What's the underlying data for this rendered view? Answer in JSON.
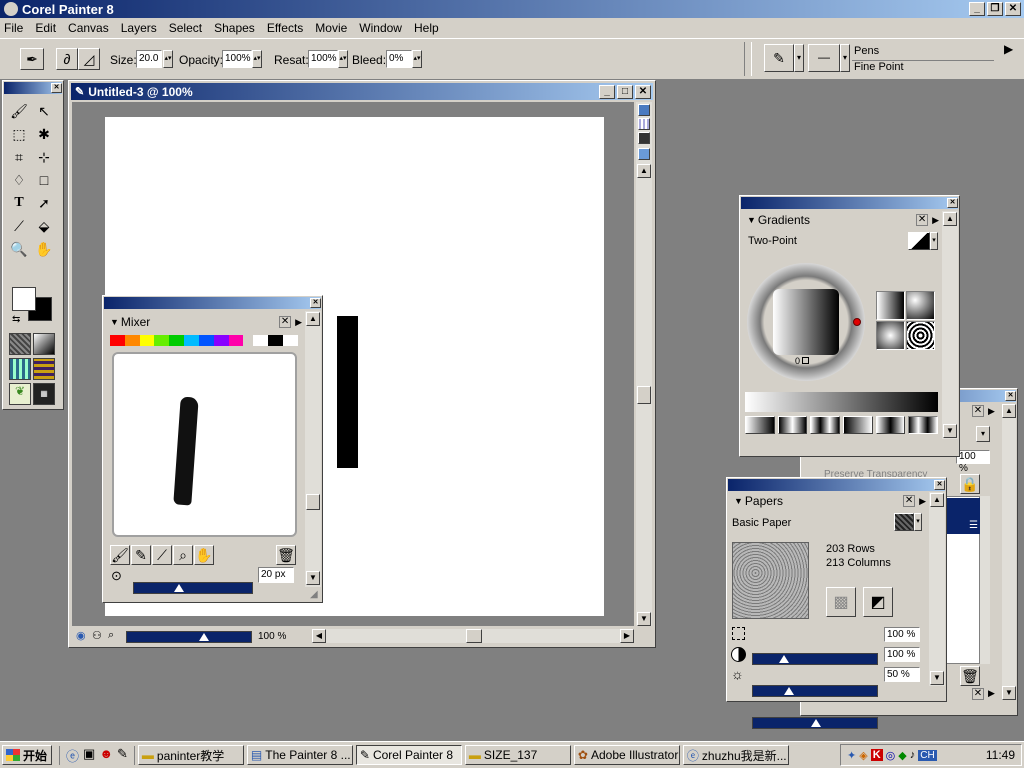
{
  "app": {
    "title": "Corel Painter 8"
  },
  "menu": [
    "File",
    "Edit",
    "Canvas",
    "Layers",
    "Select",
    "Shapes",
    "Effects",
    "Movie",
    "Window",
    "Help"
  ],
  "propbar": {
    "size_label": "Size:",
    "size_value": "20.0",
    "opacity_label": "Opacity:",
    "opacity_value": "100%",
    "resat_label": "Resat:",
    "resat_value": "100%",
    "bleed_label": "Bleed:",
    "bleed_value": "0%",
    "brush_category": "Pens",
    "brush_variant": "Fine Point"
  },
  "document": {
    "title": "Untitled-3 @ 100%",
    "zoom": "100 %"
  },
  "mixer": {
    "title": "Mixer",
    "size": "20 px",
    "swatches": [
      "#ff0000",
      "#ff8800",
      "#ffff00",
      "#66ee00",
      "#00cc00",
      "#00bbff",
      "#0055ff",
      "#8800ff",
      "#ff00aa",
      "#ffffff",
      "#000000",
      "#ffffff"
    ]
  },
  "gradients": {
    "title": "Gradients",
    "type": "Two-Point",
    "angle": "0"
  },
  "papers": {
    "title": "Papers",
    "name": "Basic Paper",
    "rows": "203 Rows",
    "columns": "213 Columns",
    "slider1": "100 %",
    "slider2": "100 %",
    "slider3": "50 %"
  },
  "layers_partial": {
    "value": "100 %",
    "preserve": "Preserve Transparency"
  },
  "taskbar": {
    "start": "开始",
    "items": [
      "paninter教学",
      "The Painter 8 ...",
      "Corel Painter 8",
      "SIZE_137",
      "Adobe Illustrator",
      "zhuzhu我是新..."
    ],
    "clock": "11:49",
    "tray_label": "CH"
  },
  "colors": {
    "accent": "#0a246a",
    "chrome": "#d4d0c8"
  }
}
